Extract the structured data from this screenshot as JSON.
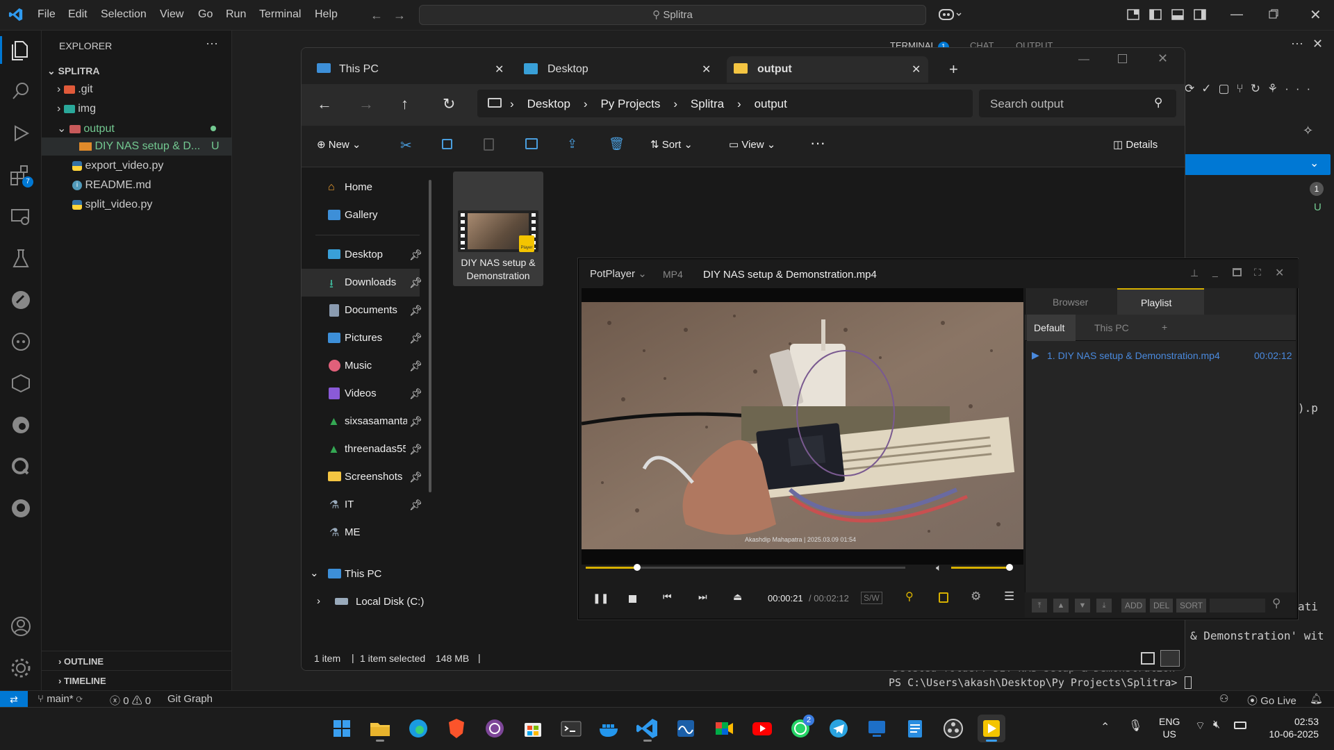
{
  "vscode": {
    "menu": [
      "File",
      "Edit",
      "Selection",
      "View",
      "Go",
      "Run",
      "Terminal",
      "Help"
    ],
    "command_center": "Splitra",
    "explorer_title": "EXPLORER",
    "project": "SPLITRA",
    "tree": [
      {
        "label": ".git"
      },
      {
        "label": "img"
      },
      {
        "label": "output"
      },
      {
        "label": "DIY NAS setup & D...",
        "badge": "U"
      },
      {
        "label": "export_video.py"
      },
      {
        "label": "README.md"
      },
      {
        "label": "split_video.py"
      }
    ],
    "extensions_badge": "7",
    "outline": "OUTLINE",
    "timeline": "TIMELINE",
    "panel_tabs": [
      "TERMINAL",
      "CHAT",
      "OUTPUT"
    ],
    "terminal_badge": "1",
    "scm_count": "1",
    "scm_status": "U",
    "terminal_frag_1": ").p",
    "terminal_frag_2": "ati",
    "terminal_frag_3": "& Demonstration' wit",
    "terminal_deleted": "Deleted folder: DIY NAS setup & Demonstration",
    "terminal_prompt": "PS C:\\Users\\akash\\Desktop\\Py Projects\\Splitra>",
    "status": {
      "branch": "main*",
      "errors": "0",
      "warnings": "0",
      "git_graph": "Git Graph",
      "go_live": "Go Live"
    }
  },
  "explorer": {
    "tabs": [
      "This PC",
      "Desktop",
      "output"
    ],
    "breadcrumb": [
      "Desktop",
      "Py Projects",
      "Splitra",
      "output"
    ],
    "search_placeholder": "Search output",
    "toolbar": {
      "new": "New",
      "sort": "Sort",
      "view": "View",
      "details": "Details"
    },
    "nav": [
      {
        "label": "Home"
      },
      {
        "label": "Gallery"
      },
      {
        "label": "Desktop",
        "pinned": true
      },
      {
        "label": "Downloads",
        "pinned": true
      },
      {
        "label": "Documents",
        "pinned": true
      },
      {
        "label": "Pictures",
        "pinned": true
      },
      {
        "label": "Music",
        "pinned": true
      },
      {
        "label": "Videos",
        "pinned": true
      },
      {
        "label": "sixsasamanta",
        "pinned": true
      },
      {
        "label": "threenadas55",
        "pinned": true
      },
      {
        "label": "Screenshots",
        "pinned": true
      },
      {
        "label": "IT",
        "pinned": true
      },
      {
        "label": "ME"
      },
      {
        "label": "This PC"
      },
      {
        "label": "Local Disk (C:)"
      }
    ],
    "file_name_1": "DIY NAS setup &",
    "file_name_2": "Demonstration",
    "file_badge": "Player",
    "status_items": "1 item",
    "status_selected": "1 item selected",
    "status_size": "148 MB"
  },
  "potplayer": {
    "app": "PotPlayer",
    "format": "MP4",
    "title": "DIY NAS setup & Demonstration.mp4",
    "tabs": [
      "Browser",
      "Playlist"
    ],
    "subtabs": [
      "Default",
      "This PC",
      "+"
    ],
    "playlist_item": "1. DIY NAS setup & Demonstration.mp4",
    "playlist_duration": "00:02:12",
    "current_time": "00:00:21",
    "total_time": "/ 00:02:12",
    "sw": "S/W",
    "progress": 0.16,
    "volume": 1.0,
    "watermark": "Akashdip Mahapatra | 2025.03.09 01:54",
    "bottom_buttons": [
      "ADD",
      "DEL",
      "SORT"
    ]
  },
  "taskbar": {
    "lang_1": "ENG",
    "lang_2": "US",
    "time": "02:53",
    "date": "10-06-2025",
    "whatsapp_badge": "2"
  }
}
